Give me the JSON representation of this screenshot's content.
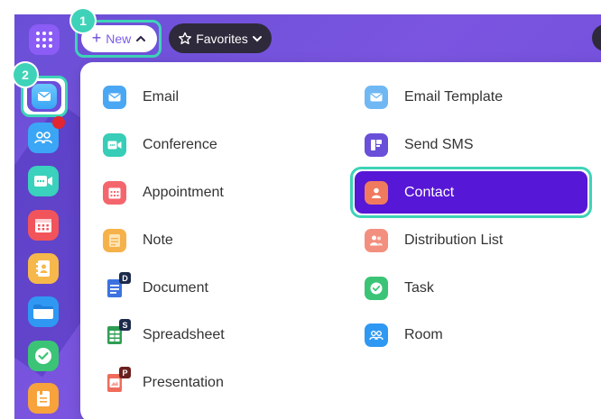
{
  "toolbar": {
    "new_label": "New",
    "favorites_label": "Favorites"
  },
  "badges": {
    "step1": "1",
    "step2": "2"
  },
  "sidebar": {
    "items": [
      {
        "name": "mail",
        "color": "#5aa9f5"
      },
      {
        "name": "contacts",
        "color": "#3aa6f5"
      },
      {
        "name": "conference",
        "color": "#3ad1bd"
      },
      {
        "name": "calendar",
        "color": "#f2545b"
      },
      {
        "name": "address-book",
        "color": "#f7b84b"
      },
      {
        "name": "files",
        "color": "#2f98f2"
      },
      {
        "name": "tasks",
        "color": "#3bc476"
      },
      {
        "name": "notes",
        "color": "#f7a23b"
      }
    ]
  },
  "menu": {
    "left": [
      {
        "label": "Email",
        "icon": "envelope-icon",
        "color": "#4aa7f3"
      },
      {
        "label": "Conference",
        "icon": "video-icon",
        "color": "#37cdb7"
      },
      {
        "label": "Appointment",
        "icon": "calendar-icon",
        "color": "#f4666d"
      },
      {
        "label": "Note",
        "icon": "note-icon",
        "color": "#f6b24a"
      },
      {
        "label": "Document",
        "icon": "document-icon",
        "color": "#3c72e0",
        "tag": "D"
      },
      {
        "label": "Spreadsheet",
        "icon": "spreadsheet-icon",
        "color": "#2f9e54",
        "tag": "S"
      },
      {
        "label": "Presentation",
        "icon": "presentation-icon",
        "color": "#ef6c5c",
        "tag": "P"
      }
    ],
    "right": [
      {
        "label": "Email Template",
        "icon": "envelope-template-icon",
        "color": "#6fb8f3"
      },
      {
        "label": "Send SMS",
        "icon": "sms-icon",
        "color": "#6a4fd9"
      },
      {
        "label": "Contact",
        "icon": "contact-icon",
        "color": "#f07a5e",
        "selected": true
      },
      {
        "label": "Distribution List",
        "icon": "distribution-list-icon",
        "color": "#f38f7e"
      },
      {
        "label": "Task",
        "icon": "task-icon",
        "color": "#3bc476"
      },
      {
        "label": "Room",
        "icon": "room-icon",
        "color": "#2f98f2"
      }
    ]
  },
  "colors": {
    "accent_highlight": "#3ed3b8",
    "selected_bg": "#5717d6",
    "topbar_gradient": "#6a4fd6"
  }
}
